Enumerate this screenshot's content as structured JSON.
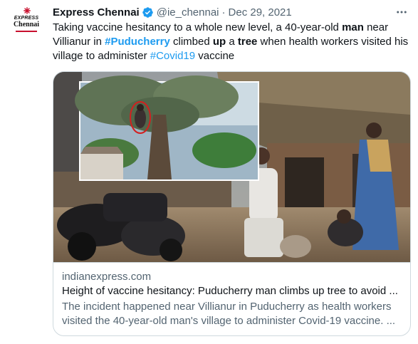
{
  "account": {
    "display_name": "Express Chennai",
    "handle": "@ie_chennai",
    "separator": "·",
    "date": "Dec 29, 2021",
    "logo_top": "EXPRESS",
    "logo_bottom": "Chennai"
  },
  "tweet": {
    "segments": [
      {
        "text": "Taking vaccine hesitancy to a whole new level, a 40-year-old ",
        "style": "plain"
      },
      {
        "text": "man",
        "style": "bold"
      },
      {
        "text": " near Villianur in ",
        "style": "plain"
      },
      {
        "text": "#Puducherry",
        "style": "hashtag-bold"
      },
      {
        "text": " climbed ",
        "style": "plain"
      },
      {
        "text": "up",
        "style": "bold"
      },
      {
        "text": " a ",
        "style": "plain"
      },
      {
        "text": "tree",
        "style": "bold"
      },
      {
        "text": " when health workers visited his village to administer ",
        "style": "plain"
      },
      {
        "text": "#Covid19",
        "style": "hashtag"
      },
      {
        "text": " vaccine",
        "style": "plain"
      }
    ]
  },
  "card": {
    "domain": "indianexpress.com",
    "title": "Height of vaccine hesitancy: Puducherry man climbs up tree to avoid ...",
    "description": "The incident happened near Villianur in Puducherry as health workers visited the 40-year-old man's village to administer Covid-19 vaccine. ..."
  },
  "colors": {
    "link": "#1d9bf0",
    "verified": "#1d9bf0",
    "secondary_text": "#536471",
    "border": "#cfd9de",
    "logo_accent": "#c8102e"
  },
  "icons": {
    "verified": "verified-badge-icon",
    "more": "more-horizontal-icon"
  }
}
